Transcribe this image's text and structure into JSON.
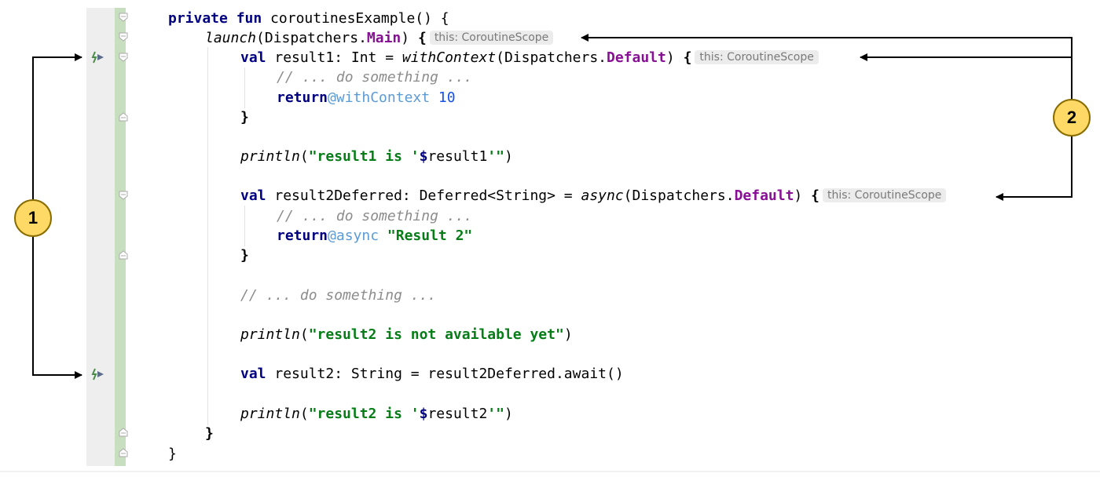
{
  "code": {
    "l1": {
      "kw1": "private",
      "kw2": "fun",
      "rest": " coroutinesExample() {"
    },
    "l2": {
      "fn": "launch",
      "p1": "(Dispatchers.",
      "prop": "Main",
      "p2": ") ",
      "brace": "{",
      "hint": "this: CoroutineScope"
    },
    "l3": {
      "kw": "val",
      "p1": " result1: Int = ",
      "fn": "withContext",
      "p2": "(Dispatchers.",
      "prop": "Default",
      "p3": ") ",
      "brace": "{",
      "hint": "this: CoroutineScope"
    },
    "l4": {
      "comment": "// ... do something ..."
    },
    "l5": {
      "kw": "return",
      "label": "@withContext",
      "num": " 10"
    },
    "l6": {
      "brace": "}"
    },
    "l8": {
      "fn": "println",
      "p1": "(",
      "s1": "\"result1 is '",
      "dollar": "$",
      "p2": "result1",
      "s2": "'\"",
      "p3": ")"
    },
    "l10": {
      "kw": "val",
      "p1": " result2Deferred: Deferred<String> = ",
      "fn": "async",
      "p2": "(Dispatchers.",
      "prop": "Default",
      "p3": ") ",
      "brace": "{",
      "hint": "this: CoroutineScope"
    },
    "l11": {
      "comment": "// ... do something ..."
    },
    "l12": {
      "kw": "return",
      "label": "@async",
      "str": " \"Result 2\""
    },
    "l13": {
      "brace": "}"
    },
    "l15": {
      "comment": "// ... do something ..."
    },
    "l17": {
      "fn": "println",
      "p1": "(",
      "str": "\"result2 is not available yet\"",
      "p2": ")"
    },
    "l19": {
      "kw": "val",
      "rest": " result2: String = result2Deferred.await()"
    },
    "l21": {
      "fn": "println",
      "p1": "(",
      "s1": "\"result2 is '",
      "dollar": "$",
      "p2": "result2",
      "s2": "'\"",
      "p3": ")"
    },
    "l22": {
      "brace": "}"
    },
    "l23": {
      "brace": "}"
    }
  },
  "callouts": {
    "one": "1",
    "two": "2"
  },
  "icons": {
    "gutter_suspend": "suspend-call-icon",
    "gutter_fold": "fold-marker-icon"
  },
  "colors": {
    "keyword": "#000080",
    "string": "#067d17",
    "number": "#1750eb",
    "property": "#871094",
    "comment": "#8c8c8c",
    "label": "#5b9bd5",
    "callout": "#ffd966",
    "gutter_bar": "#c7dfbe"
  }
}
